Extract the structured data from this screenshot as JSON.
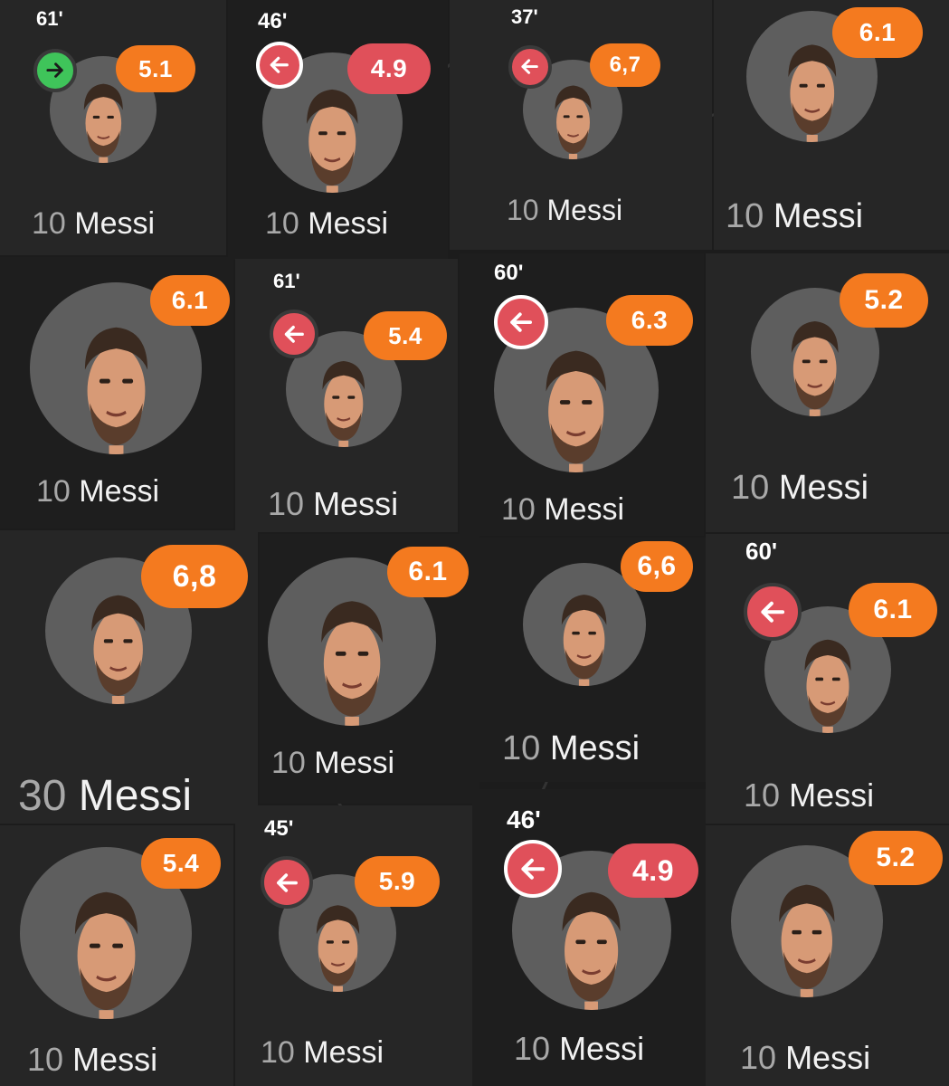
{
  "colors": {
    "rating_orange": "#f47a1f",
    "rating_red": "#e0505a",
    "sub_in_green": "#3fc45a",
    "sub_out_red": "#e0505a",
    "background": "#1c1c1c"
  },
  "icons": {
    "sub_in": "arrow-right-icon",
    "sub_out": "arrow-left-icon"
  },
  "cards": [
    {
      "number": "10",
      "name": "Messi",
      "rating": "5.1",
      "rating_color": "orange",
      "minute": "61'",
      "sub": "in"
    },
    {
      "number": "10",
      "name": "Messi",
      "rating": "4.9",
      "rating_color": "red",
      "minute": "46'",
      "sub": "out"
    },
    {
      "number": "10",
      "name": "Messi",
      "rating": "6,7",
      "rating_color": "orange",
      "minute": "37'",
      "sub": "out"
    },
    {
      "number": "10",
      "name": "Messi",
      "rating": "6.1",
      "rating_color": "orange",
      "minute": "",
      "sub": ""
    },
    {
      "number": "10",
      "name": "Messi",
      "rating": "6.1",
      "rating_color": "orange",
      "minute": "",
      "sub": ""
    },
    {
      "number": "10",
      "name": "Messi",
      "rating": "5.4",
      "rating_color": "orange",
      "minute": "61'",
      "sub": "out"
    },
    {
      "number": "10",
      "name": "Messi",
      "rating": "6.3",
      "rating_color": "orange",
      "minute": "60'",
      "sub": "out"
    },
    {
      "number": "10",
      "name": "Messi",
      "rating": "5.2",
      "rating_color": "orange",
      "minute": "",
      "sub": ""
    },
    {
      "number": "30",
      "name": "Messi",
      "rating": "6,8",
      "rating_color": "orange",
      "minute": "",
      "sub": ""
    },
    {
      "number": "10",
      "name": "Messi",
      "rating": "6.1",
      "rating_color": "orange",
      "minute": "",
      "sub": ""
    },
    {
      "number": "10",
      "name": "Messi",
      "rating": "6,6",
      "rating_color": "orange",
      "minute": "",
      "sub": ""
    },
    {
      "number": "10",
      "name": "Messi",
      "rating": "6.1",
      "rating_color": "orange",
      "minute": "60'",
      "sub": "out"
    },
    {
      "number": "10",
      "name": "Messi",
      "rating": "5.4",
      "rating_color": "orange",
      "minute": "",
      "sub": ""
    },
    {
      "number": "10",
      "name": "Messi",
      "rating": "5.9",
      "rating_color": "orange",
      "minute": "45'",
      "sub": "out"
    },
    {
      "number": "10",
      "name": "Messi",
      "rating": "4.9",
      "rating_color": "red",
      "minute": "46'",
      "sub": "out"
    },
    {
      "number": "10",
      "name": "Messi",
      "rating": "5.2",
      "rating_color": "orange",
      "minute": "",
      "sub": ""
    }
  ]
}
